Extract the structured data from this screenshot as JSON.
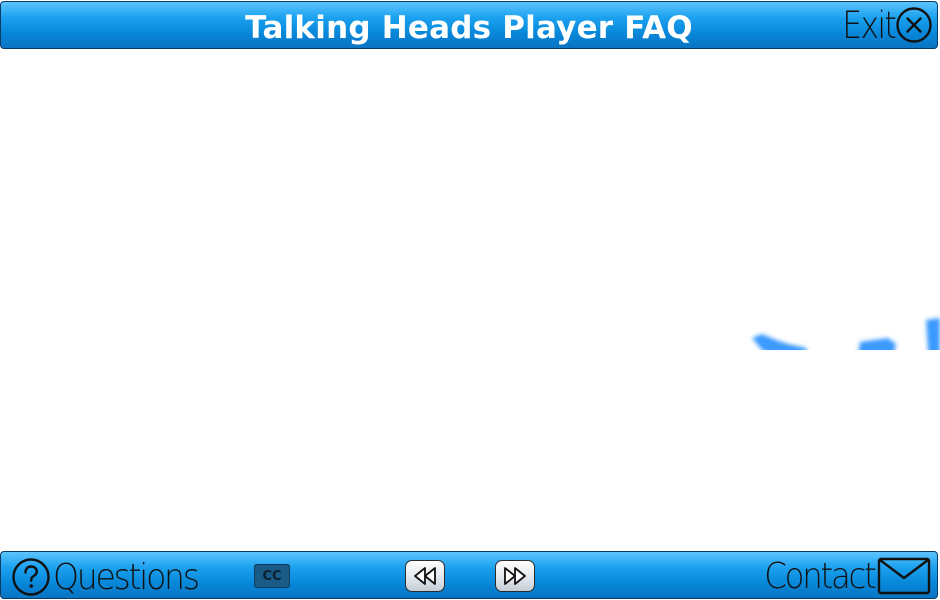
{
  "window": {
    "title": "Talking Heads Player FAQ"
  },
  "header": {
    "exit_label": "Exit",
    "exit_icon": "close-circle-icon"
  },
  "footer": {
    "questions_label": "Questions",
    "questions_icon": "help-circle-icon",
    "cc_label": "CC",
    "rewind_icon": "rewind-icon",
    "forward_icon": "fast-forward-icon",
    "contact_label": "Contact",
    "contact_icon": "mail-envelope-icon"
  },
  "colors": {
    "bar_blue": "#0786d8",
    "bar_highlight": "#5cc4ff",
    "bar_border": "#0a3a66",
    "title_text": "#ffffff",
    "button_text": "#111111",
    "cc_background": "#1a5a86",
    "stage_background": "#ffffff",
    "blur_shape_blue": "#3a9aff"
  }
}
